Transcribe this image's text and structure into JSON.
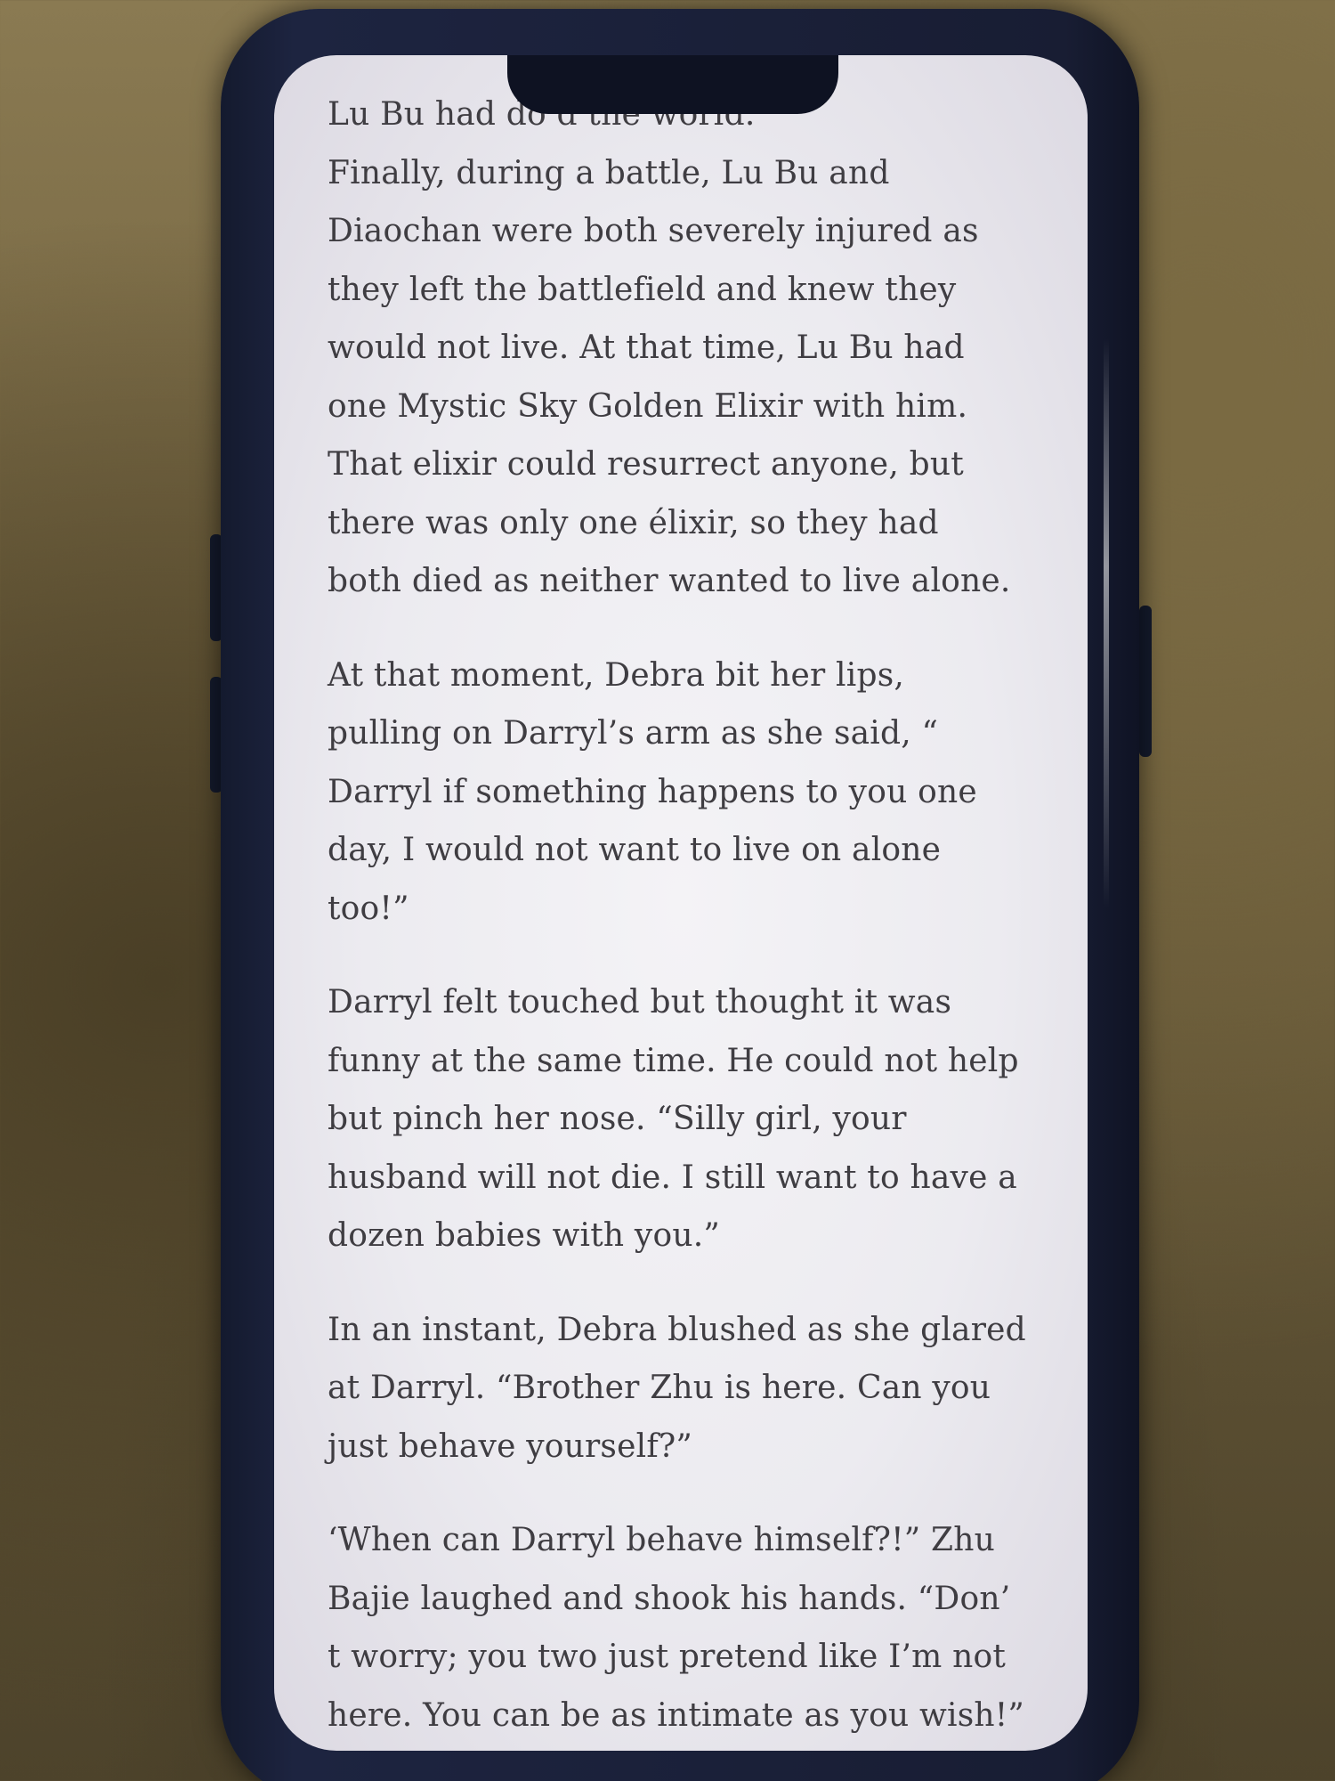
{
  "reader": {
    "paragraphs": [
      "Lu Bu had do                          d the world.\nFinally, during a battle, Lu Bu and\nDiaochan were both severely injured as\nthey left the battlefield and knew they\nwould not live. At that time, Lu Bu had\none Mystic Sky Golden Elixir with him.\nThat elixir could resurrect anyone, but\nthere was only one élixir, so they had\nboth died as neither wanted to live alone.",
      "At that moment, Debra bit her lips,\npulling on Darryl’s arm as she said, “\nDarryl if something happens to you one\nday, I would not want to live on alone\ntoo!”",
      "Darryl felt touched but thought it was\nfunny at the same time. He could not help\nbut pinch her nose. “Silly girl, your\nhusband will not die. I still want to have a\ndozen babies with you.”",
      "In an instant, Debra blushed as she glared\nat Darryl. “Brother Zhu is here. Can you\njust behave yourself?”",
      "‘When can Darryl behave himself?!” Zhu\nBajie laughed and shook his hands. “Don’\nt worry; you two just pretend like I’m not\nhere. You can be as intimate as you wish!”"
    ]
  },
  "colors": {
    "text": "#3f3d42",
    "screen": "#ecebf0",
    "phone_frame": "#181d33",
    "background": "#6b5c3a"
  }
}
